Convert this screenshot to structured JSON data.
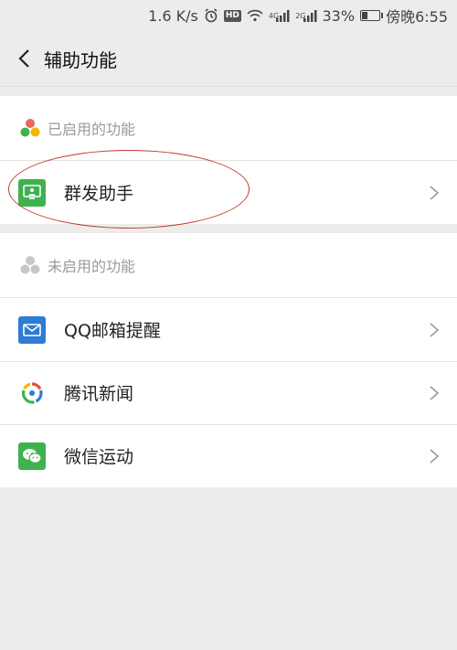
{
  "status_bar": {
    "speed": "1.6 K/s",
    "hd": "HD",
    "net1": "4G",
    "net2": "2G",
    "battery_percent": "33%",
    "battery_level": 0.33,
    "time": "傍晚6:55"
  },
  "header": {
    "title": "辅助功能"
  },
  "sections": {
    "enabled": {
      "title": "已启用的功能",
      "items": [
        {
          "label": "群发助手",
          "icon": "group-message-icon",
          "color": "#3fb24f"
        }
      ]
    },
    "disabled": {
      "title": "未启用的功能",
      "items": [
        {
          "label": "QQ邮箱提醒",
          "icon": "mail-icon",
          "color": "#2f7cd4"
        },
        {
          "label": "腾讯新闻",
          "icon": "tencent-news-icon",
          "color": "#ffffff"
        },
        {
          "label": "微信运动",
          "icon": "wechat-sport-icon",
          "color": "#3fb24f"
        }
      ]
    }
  },
  "colors": {
    "highlight_ellipse": "#c0392b",
    "enabled_dots": [
      "#e9675c",
      "#3fb24f",
      "#f4b400"
    ],
    "disabled_dots": "#c7c7c7"
  }
}
